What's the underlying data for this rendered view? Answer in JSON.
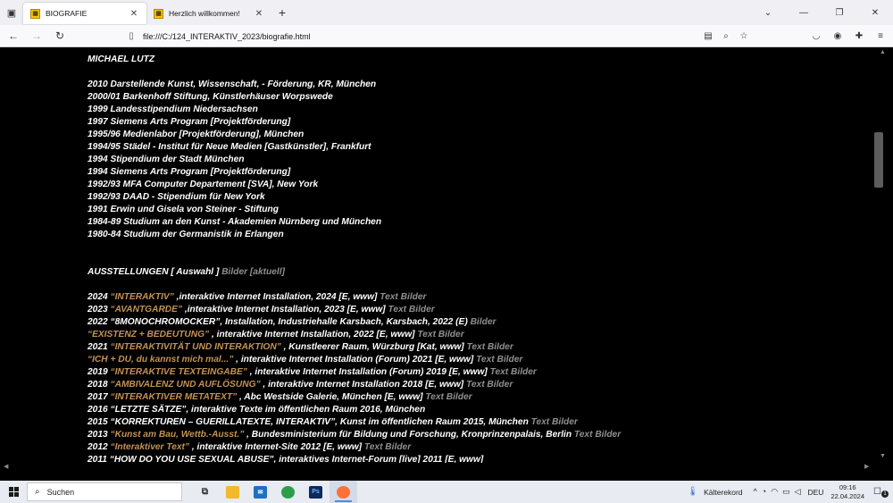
{
  "browser": {
    "tabs": [
      {
        "title": "BIOGRAFIE",
        "active": true
      },
      {
        "title": "Herzlich willkommen!",
        "active": false
      }
    ],
    "url": "file:///C:/124_INTERAKTIV_2023/biografie.html",
    "icons": {
      "tab_list": "tab-list-icon",
      "close": "close-icon",
      "new_tab": "plus-icon",
      "back": "arrow-left-icon",
      "forward": "arrow-right-icon",
      "reload": "reload-icon",
      "reader": "reader-view-icon",
      "zoom": "magnifier-icon",
      "bookmark": "star-icon"
    }
  },
  "page": {
    "name": "MICHAEL LUTZ",
    "bio": [
      "2010 Darstellende Kunst, Wissenschaft, - Förderung, KR, München",
      "2000/01 Barkenhoff Stiftung, Künstlerhäuser Worpswede",
      "1999 Landesstipendium Niedersachsen",
      "1997 Siemens Arts Program [Projektförderung]",
      "1995/96 Medienlabor [Projektförderung], München",
      "1994/95 Städel - Institut für Neue Medien [Gastkünstler], Frankfurt",
      "1994 Stipendium der Stadt München",
      "1994 Siemens Arts Program [Projektförderung]",
      "1992/93 MFA Computer Departement [SVA], New York",
      "1992/93 DAAD - Stipendium für New York",
      "1991 Erwin und Gisela von Steiner - Stiftung",
      "1984-89 Studium an den Kunst - Akademien Nürnberg und München",
      "1980-84 Studium der Germanistik in Erlangen"
    ],
    "exhibitions_heading": {
      "label": "AUSSTELLUNGEN [ Auswahl ]",
      "links": "Bilder [aktuell]"
    },
    "exhibitions": [
      {
        "year": "2024 ",
        "title": "“INTERAKTIV”",
        "text": " ,interaktive Internet Installation, 2024 [E, www] ",
        "links": "Text Bilder"
      },
      {
        "year": "2023 ",
        "title": "“AVANTGARDE”",
        "text": " ,interaktive Internet Installation, 2023 [E, www] ",
        "links": "Text Bilder"
      },
      {
        "year": "2022 ",
        "title": "",
        "text": "“8MONOCHROMOCKER”, Installation, Industriehalle Karsbach, Karsbach, 2022 (E) ",
        "links": "Bilder"
      },
      {
        "year": "",
        "title": "“EXISTENZ + BEDEUTUNG”",
        "text": " , interaktive Internet Installation, 2022 [E, www] ",
        "links": "Text Bilder"
      },
      {
        "year": "2021 ",
        "title": "“INTERAKTIVITÄT UND INTERAKTION”",
        "text": " , Kunstleerer Raum, Würzburg [Kat, www] ",
        "links": "Text Bilder"
      },
      {
        "year": "",
        "title": "“ICH + DU, du kannst mich mal...”",
        "text": " , interaktive Internet Installation (Forum) 2021 [E, www] ",
        "links": "Text Bilder"
      },
      {
        "year": "2019 ",
        "title": "“INTERAKTIVE TEXTEINGABE”",
        "text": " , interaktive Internet Installation (Forum) 2019 [E, www] ",
        "links": "Text Bilder"
      },
      {
        "year": "2018 ",
        "title": "“AMBIVALENZ UND AUFLÖSUNG”",
        "text": " , interaktive Internet Installation 2018 [E, www] ",
        "links": "Text Bilder"
      },
      {
        "year": "2017 ",
        "title": "“INTERAKTIVER METATEXT”",
        "text": " , Abc Westside Galerie, München [E, www] ",
        "links": "Text Bilder"
      },
      {
        "year": "2016 ",
        "title": "",
        "text": "“LETZTE SÄTZE”, interaktive Texte im öffentlichen Raum 2016, München",
        "links": ""
      },
      {
        "year": "2015 ",
        "title": "",
        "text": "“KORREKTUREN – GUERILLATEXTE, INTERAKTIV”, Kunst im öffentlichen Raum 2015, München ",
        "links": "Text Bilder"
      },
      {
        "year": "2013 ",
        "title": "“Kunst am Bau, Wettb.-Ausst.”",
        "text": " , Bundesministerium für Bildung und Forschung, Kronprinzenpalais, Berlin ",
        "links": "Text Bilder"
      },
      {
        "year": "2012 ",
        "title": "“Interaktiver Text”",
        "text": " , interaktive Internet-Site 2012 [E, www] ",
        "links": "Text Bilder"
      },
      {
        "year": "2011 ",
        "title": "",
        "text": "“HOW DO YOU USE SEXUAL ABUSE”, interaktives Internet-Forum [live] 2011 [E, www]",
        "links": ""
      }
    ]
  },
  "taskbar": {
    "search_placeholder": "Suchen",
    "weather": "Kälterekord",
    "language": "DEU",
    "time": "09:16",
    "date": "22.04.2024",
    "notifications": "1",
    "colors": {
      "accent": "#4a90e2",
      "link_orange": "#c49256",
      "link_gray": "#8f8f8f"
    }
  }
}
